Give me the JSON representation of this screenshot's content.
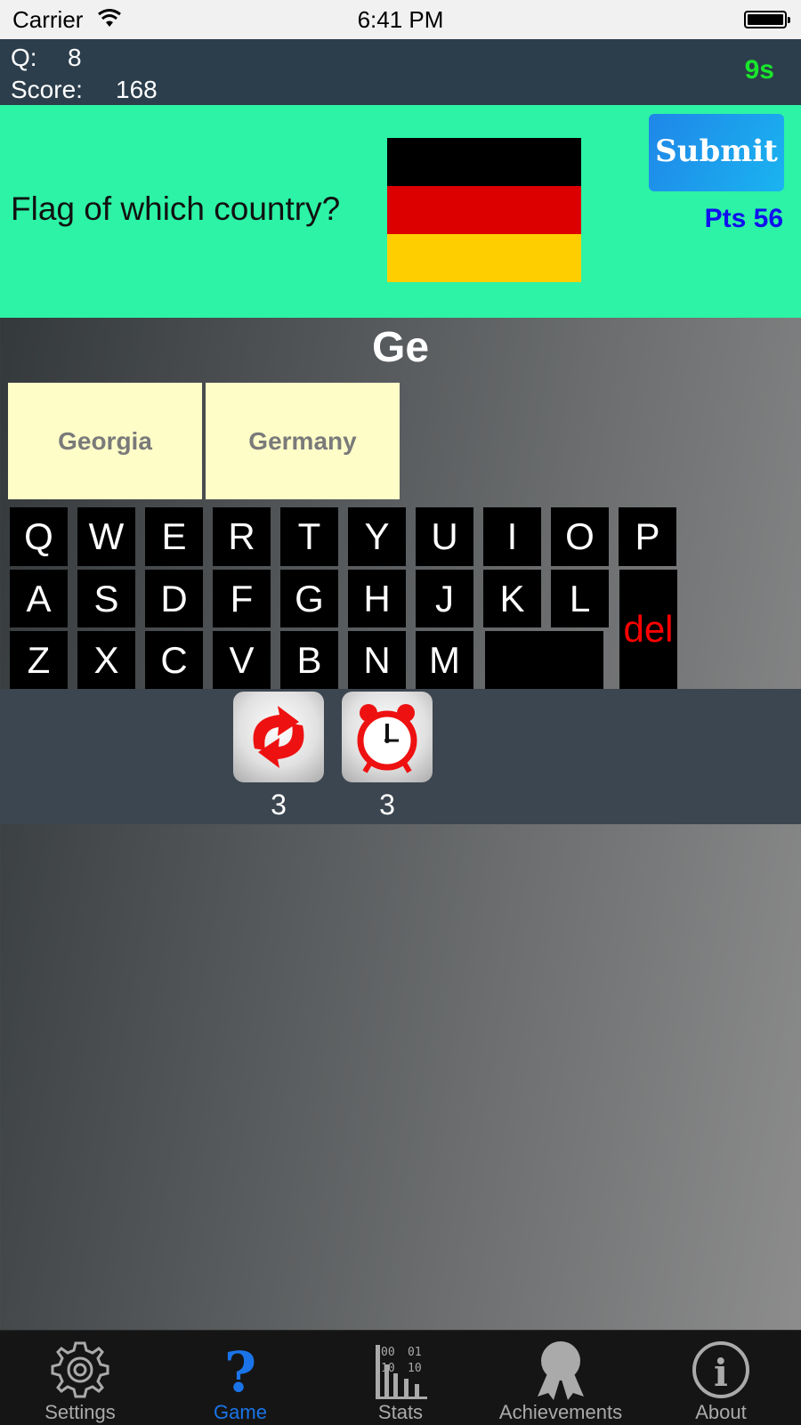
{
  "status_bar": {
    "carrier": "Carrier",
    "time": "6:41 PM"
  },
  "score_bar": {
    "q_label": "Q:",
    "q_value": "8",
    "score_label": "Score:",
    "score_value": "168",
    "timer": "9s"
  },
  "question": {
    "text": "Flag of which country?",
    "flag_colors": [
      "#000000",
      "#dd0000",
      "#ffce00"
    ],
    "submit_label": "Submit",
    "points": "Pts 56"
  },
  "answer": {
    "typed": "Ge"
  },
  "suggestions": [
    "Georgia",
    "Germany"
  ],
  "keyboard": {
    "row1": [
      "Q",
      "W",
      "E",
      "R",
      "T",
      "Y",
      "U",
      "I",
      "O",
      "P"
    ],
    "row2": [
      "A",
      "S",
      "D",
      "F",
      "G",
      "H",
      "J",
      "K",
      "L"
    ],
    "row3": [
      "Z",
      "X",
      "C",
      "V",
      "B",
      "N",
      "M"
    ],
    "del_label": "del"
  },
  "powerups": [
    {
      "name": "refresh-icon",
      "count": "3"
    },
    {
      "name": "alarm-clock-icon",
      "count": "3"
    }
  ],
  "tabs": [
    {
      "label": "Settings",
      "icon": "gear-icon",
      "active": false
    },
    {
      "label": "Game",
      "icon": "question-mark-icon",
      "active": true
    },
    {
      "label": "Stats",
      "icon": "stats-icon",
      "active": false
    },
    {
      "label": "Achievements",
      "icon": "ribbon-icon",
      "active": false
    },
    {
      "label": "About",
      "icon": "info-icon",
      "active": false
    }
  ],
  "colors": {
    "header_bg": "#2c3e4c",
    "question_bg": "#2cf3a5",
    "timer": "#19e62b",
    "points": "#1010ee",
    "suggestion_bg": "#fefdc8",
    "tab_active": "#1a74e8"
  }
}
